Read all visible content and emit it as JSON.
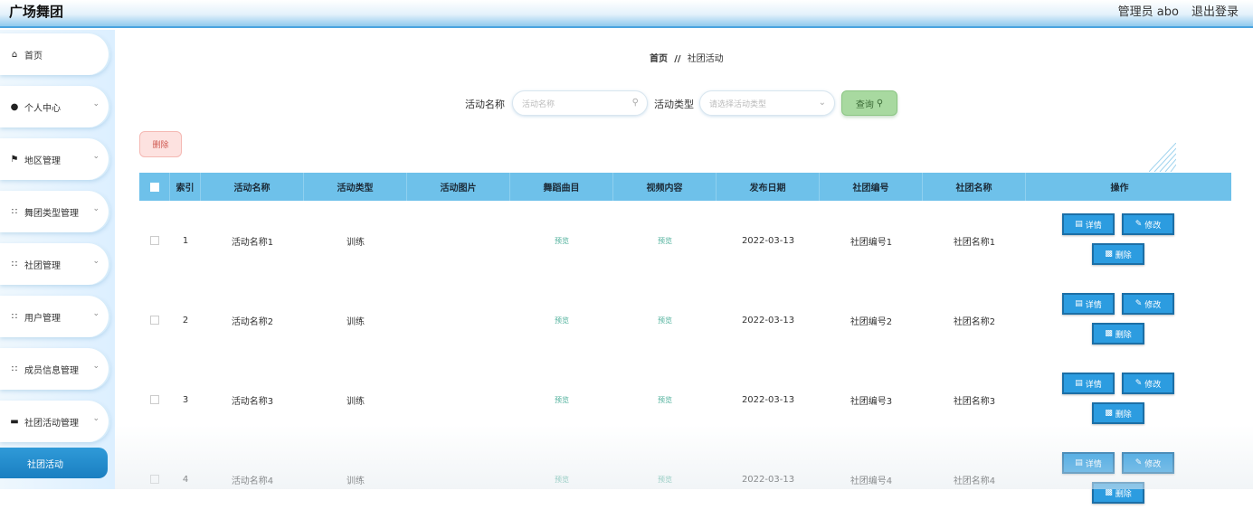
{
  "header": {
    "title": "广场舞团",
    "user": "管理员 abo",
    "logout": "退出登录"
  },
  "sidebar": {
    "items": [
      {
        "label": "首页",
        "icon": "home-icon",
        "expandable": false
      },
      {
        "label": "个人中心",
        "icon": "user-icon",
        "expandable": true
      },
      {
        "label": "地区管理",
        "icon": "flag-icon",
        "expandable": true
      },
      {
        "label": "舞团类型管理",
        "icon": "grid-icon",
        "expandable": true
      },
      {
        "label": "社团管理",
        "icon": "grid-icon",
        "expandable": true
      },
      {
        "label": "用户管理",
        "icon": "grid-icon",
        "expandable": true
      },
      {
        "label": "成员信息管理",
        "icon": "grid-icon",
        "expandable": true
      },
      {
        "label": "社团活动管理",
        "icon": "monitor-icon",
        "expandable": true
      }
    ],
    "active_sub": "社团活动"
  },
  "breadcrumb": {
    "home": "首页",
    "separator": "//",
    "current": "社团活动"
  },
  "search": {
    "name_label": "活动名称",
    "name_placeholder": "活动名称",
    "type_label": "活动类型",
    "type_placeholder": "请选择活动类型",
    "query_label": "查询"
  },
  "actions": {
    "delete_label": "删除"
  },
  "table": {
    "columns": [
      "索引",
      "活动名称",
      "活动类型",
      "活动图片",
      "舞蹈曲目",
      "视频内容",
      "发布日期",
      "社团编号",
      "社团名称",
      "操作"
    ],
    "rows": [
      {
        "index": "1",
        "name": "活动名称1",
        "type": "训练",
        "image": "",
        "music": "预览",
        "video": "预览",
        "date": "2022-03-13",
        "club_no": "社团编号1",
        "club_name": "社团名称1"
      },
      {
        "index": "2",
        "name": "活动名称2",
        "type": "训练",
        "image": "",
        "music": "预览",
        "video": "预览",
        "date": "2022-03-13",
        "club_no": "社团编号2",
        "club_name": "社团名称2"
      },
      {
        "index": "3",
        "name": "活动名称3",
        "type": "训练",
        "image": "",
        "music": "预览",
        "video": "预览",
        "date": "2022-03-13",
        "club_no": "社团编号3",
        "club_name": "社团名称3"
      },
      {
        "index": "4",
        "name": "活动名称4",
        "type": "训练",
        "image": "",
        "music": "预览",
        "video": "预览",
        "date": "2022-03-13",
        "club_no": "社团编号4",
        "club_name": "社团名称4"
      }
    ],
    "row_actions": {
      "detail": "详情",
      "edit": "修改",
      "delete": "删除"
    }
  },
  "colors": {
    "accent": "#2c9ce0",
    "header_bar": "#6ec1ea",
    "query": "#a8d9a0",
    "danger_bg": "#fde2e0",
    "preview_text": "#4caf9a"
  }
}
